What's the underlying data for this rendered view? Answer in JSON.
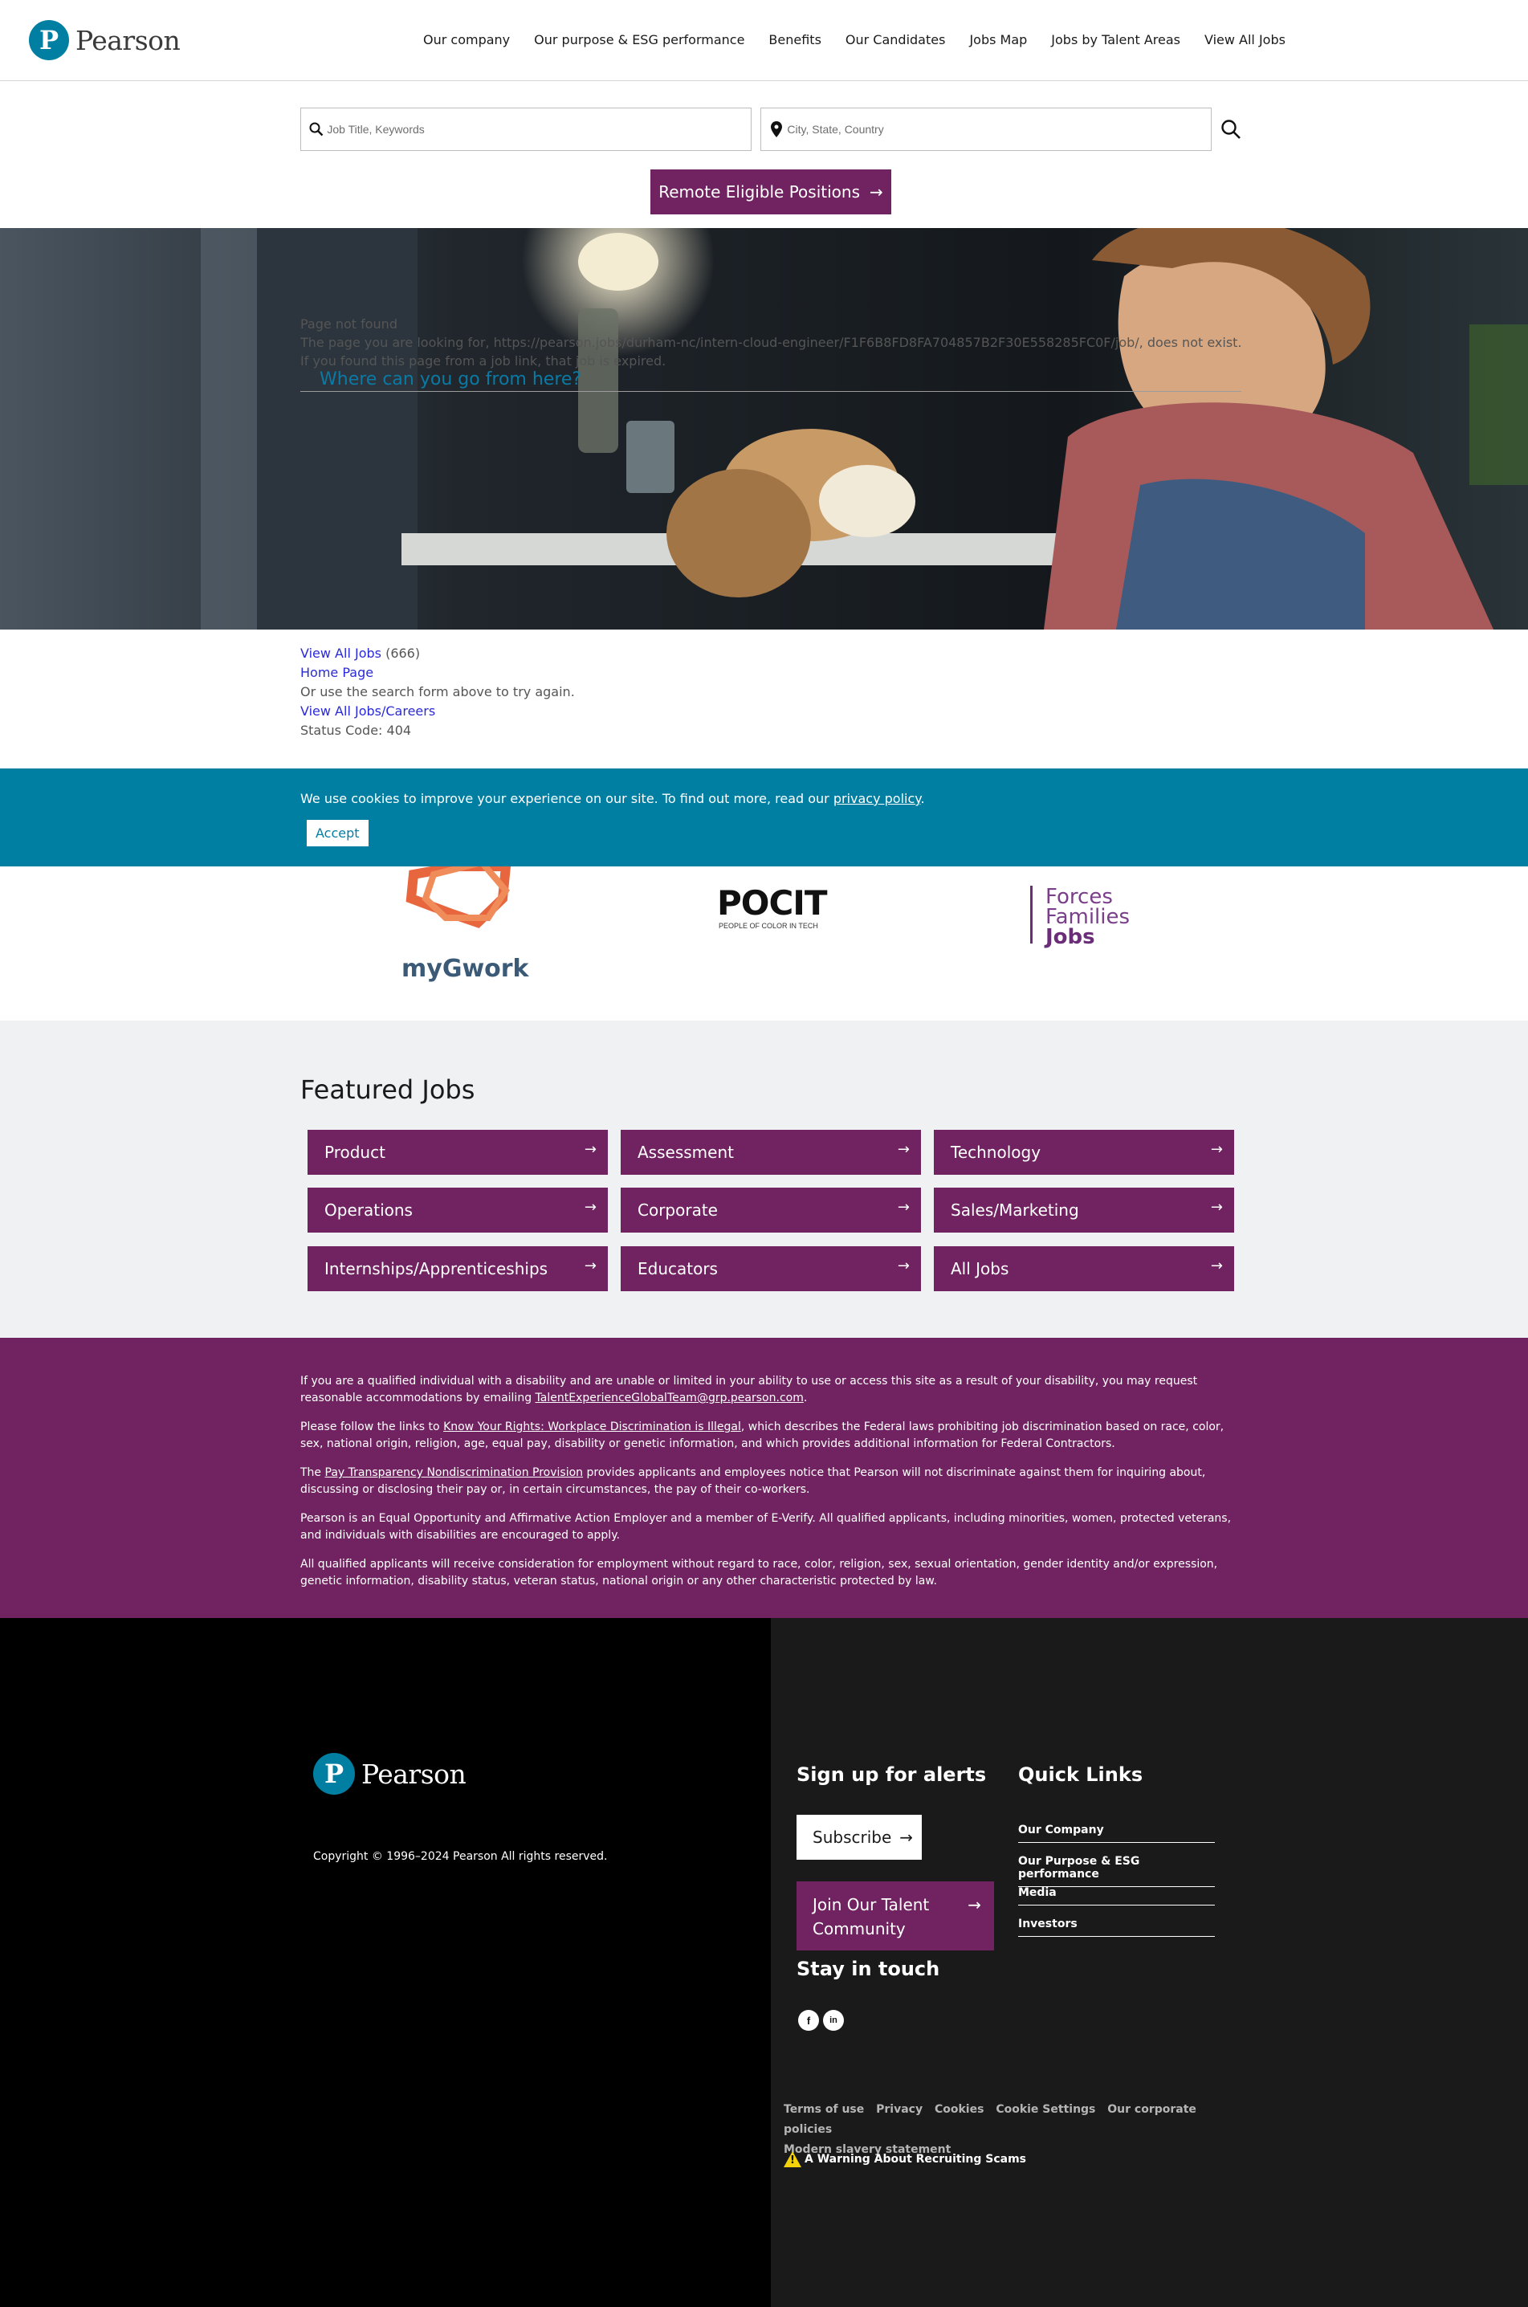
{
  "header": {
    "logo_text": "Pearson",
    "logo_letter": "P",
    "nav": [
      "Our company",
      "Our purpose & ESG performance",
      "Benefits",
      "Our Candidates",
      "Jobs Map",
      "Jobs by Talent Areas",
      "View All Jobs"
    ]
  },
  "search": {
    "keyword_placeholder": "Job Title, Keywords",
    "location_placeholder": "City, State, Country",
    "remote_button": "Remote Eligible Positions",
    "arrow": "→"
  },
  "not_found": {
    "heading": "Page not found",
    "line1": "The page you are looking for, https://pearson.jobs/durham-nc/intern-cloud-engineer/F1F6B8FD8FA704857B2F30E558285FC0F/job/, does not exist.",
    "line2": "If you found this page from a job link, that job is expired.",
    "where": "Where can you go from here?"
  },
  "links": {
    "view_all_jobs": "View All Jobs",
    "count": "(666)",
    "home_page": "Home Page",
    "search_note": "Or use the search form above to try again.",
    "careers": "View All Jobs/Careers",
    "status": "Status Code: 404"
  },
  "cookie": {
    "text": "We use cookies to improve your experience on our site. To find out more, read our ",
    "policy": "privacy policy",
    "end": ".",
    "accept": "Accept"
  },
  "partners": {
    "mygwork": "myGwork",
    "pocit": "POCIT",
    "pocit_sub": "PEOPLE OF COLOR IN TECH",
    "forces1": "Forces",
    "forces2": "Families",
    "forces3": "Jobs"
  },
  "featured": {
    "title": "Featured Jobs",
    "jobs": [
      "Product",
      "Assessment",
      "Technology",
      "Operations",
      "Corporate",
      "Sales/Marketing",
      "Internships/Apprenticeships",
      "Educators",
      "All Jobs"
    ]
  },
  "legal": {
    "p1a": "If you are a qualified individual with a disability and are unable or limited in your ability to use or access this site as a result of your disability, you may request reasonable accommodations by emailing ",
    "p1_email": "TalentExperienceGlobalTeam@grp.pearson.com",
    "p1b": ".",
    "p2a": "Please follow the links to ",
    "p2_link": "Know Your Rights: Workplace Discrimination is Illegal",
    "p2b": ", which describes the Federal laws prohibiting job discrimination based on race, color, sex, national origin, religion, age, equal pay, disability or genetic information, and which provides additional information for Federal Contractors.",
    "p3a": "The ",
    "p3_link": "Pay Transparency Nondiscrimination Provision",
    "p3b": " provides applicants and employees notice that Pearson will not discriminate against them for inquiring about, discussing or disclosing their pay or, in certain circumstances, the pay of their co-workers.",
    "p4": "Pearson is an Equal Opportunity and Affirmative Action Employer and a member of E-Verify. All qualified applicants, including minorities, women, protected veterans, and individuals with disabilities are encouraged to apply.",
    "p5": "All qualified applicants will receive consideration for employment without regard to race, color, religion, sex, sexual orientation, gender identity and/or expression, genetic information, disability status, veteran status, national origin or any other characteristic protected by law."
  },
  "footer": {
    "copyright": "Copyright © 1996–2024 Pearson All rights reserved.",
    "signup_title": "Sign up for alerts",
    "subscribe": "Subscribe",
    "join": "Join Our Talent Community",
    "stay": "Stay in touch",
    "facebook": "f",
    "linkedin": "in",
    "quick_title": "Quick Links",
    "quick_links": [
      "Our Company",
      "Our Purpose & ESG performance",
      "Media",
      "Investors"
    ],
    "bottom_links": [
      "Terms of use",
      "Privacy",
      "Cookies",
      "Cookie Settings",
      "Our corporate policies",
      "Modern slavery statement"
    ],
    "scam": "A Warning About Recruiting Scams",
    "warn_mark": "!"
  }
}
